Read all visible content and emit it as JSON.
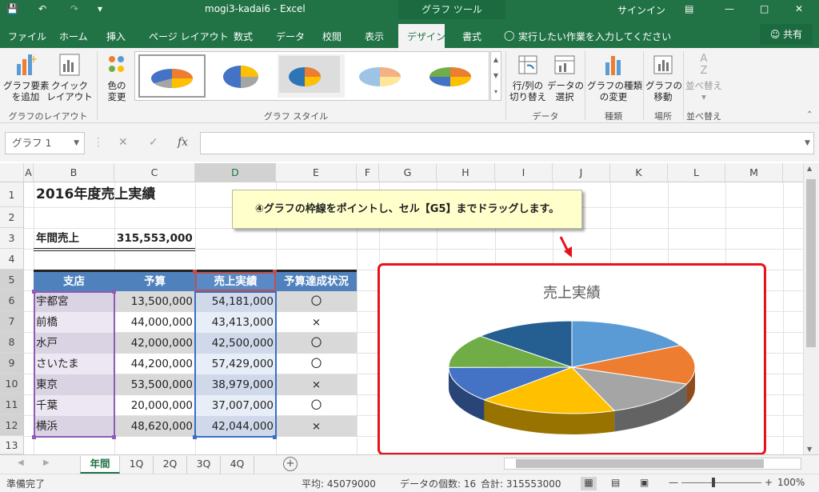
{
  "window": {
    "title": "mogi3-kadai6  -  Excel",
    "context_tab": "グラフ ツール",
    "signin": "サインイン"
  },
  "tabs": [
    "ファイル",
    "ホーム",
    "挿入",
    "ページ レイアウト",
    "数式",
    "データ",
    "校閲",
    "表示",
    "デザイン",
    "書式"
  ],
  "tell_me": "実行したい作業を入力してください",
  "share": "共有",
  "ribbon": {
    "add_element": [
      "グラフ要素",
      "を追加"
    ],
    "quick_layout": [
      "クイック",
      "レイアウト"
    ],
    "colors": [
      "色の",
      "変更"
    ],
    "switch_rowcol": [
      "行/列の",
      "切り替え"
    ],
    "select_data": [
      "データの",
      "選択"
    ],
    "change_type": [
      "グラフの種類",
      "の変更"
    ],
    "move_chart": [
      "グラフの",
      "移動"
    ],
    "sort": [
      "並べ替え"
    ],
    "groups": {
      "layout": "グラフのレイアウト",
      "styles": "グラフ スタイル",
      "data": "データ",
      "type": "種類",
      "location": "場所",
      "sort": "並べ替え"
    }
  },
  "name_box": "グラフ 1",
  "columns": [
    "A",
    "B",
    "C",
    "D",
    "E",
    "F",
    "G",
    "H",
    "I",
    "J",
    "K",
    "L",
    "M"
  ],
  "rows": [
    "1",
    "2",
    "3",
    "4",
    "5",
    "6",
    "7",
    "8",
    "9",
    "10",
    "11",
    "12",
    "13"
  ],
  "sheet": {
    "title": "2016年度売上実績",
    "annual_label": "年間売上",
    "annual_value": "315,553,000",
    "headers": [
      "支店",
      "予算",
      "売上実績",
      "予算達成状況"
    ],
    "data": [
      [
        "宇都宮",
        "13,500,000",
        "54,181,000",
        "〇"
      ],
      [
        "前橋",
        "44,000,000",
        "43,413,000",
        "×"
      ],
      [
        "水戸",
        "42,000,000",
        "42,500,000",
        "〇"
      ],
      [
        "さいたま",
        "44,200,000",
        "57,429,000",
        "〇"
      ],
      [
        "東京",
        "53,500,000",
        "38,979,000",
        "×"
      ],
      [
        "千葉",
        "20,000,000",
        "37,007,000",
        "〇"
      ],
      [
        "横浜",
        "48,620,000",
        "42,044,000",
        "×"
      ]
    ]
  },
  "callout": "④グラフの枠線をポイントし、セル【G5】までドラッグします。",
  "chart_data": {
    "type": "pie",
    "title": "売上実績",
    "categories": [
      "宇都宮",
      "前橋",
      "水戸",
      "さいたま",
      "東京",
      "千葉",
      "横浜"
    ],
    "values": [
      54181000,
      43413000,
      42500000,
      57429000,
      38979000,
      37007000,
      42044000
    ],
    "colors": [
      "#5b9bd5",
      "#ed7d31",
      "#a5a5a5",
      "#ffc000",
      "#4472c4",
      "#70ad47",
      "#255e91"
    ]
  },
  "sheet_tabs": [
    "年間",
    "1Q",
    "2Q",
    "3Q",
    "4Q"
  ],
  "status": {
    "ready": "準備完了",
    "average": "平均: 45079000",
    "count": "データの個数: 16",
    "sum": "合計: 315553000",
    "zoom": "100%"
  }
}
